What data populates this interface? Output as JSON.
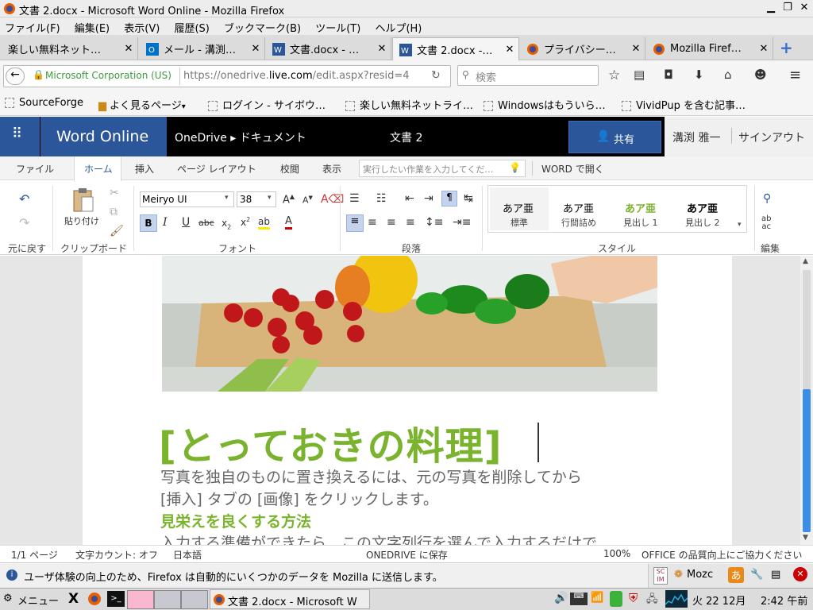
{
  "window": {
    "title": "文書 2.docx - Microsoft Word Online - Mozilla Firefox"
  },
  "menubar": [
    "ファイル(F)",
    "編集(E)",
    "表示(V)",
    "履歴(S)",
    "ブックマーク(B)",
    "ツール(T)",
    "ヘルプ(H)"
  ],
  "tabs": [
    {
      "label": "楽しい無料ネット…"
    },
    {
      "label": "メール - 溝渕…"
    },
    {
      "label": "文書.docx - …"
    },
    {
      "label": "文書 2.docx -…"
    },
    {
      "label": "プライバシー…"
    },
    {
      "label": "Mozilla Firef…"
    }
  ],
  "nav": {
    "site_identity": "Microsoft Corporation (US)",
    "url_prefix": "https://onedrive.",
    "url_domain": "live.com",
    "url_suffix": "/edit.aspx?resid=4",
    "search_placeholder": "検索"
  },
  "bookmarks": [
    "SourceForge",
    "よく見るページ",
    "ログイン - サイボウ…",
    "楽しい無料ネットライ…",
    "Windowsはもういら…",
    "VividPup を含む記事…"
  ],
  "word": {
    "app_title": "Word Online",
    "breadcrumb_root": "OneDrive",
    "breadcrumb_sep": "▸",
    "breadcrumb_folder": "ドキュメント",
    "doc_name": "文書 2",
    "share_label": "共有",
    "user_name": "溝渕 雅一",
    "signout_label": "サインアウト"
  },
  "ribbon_tabs": [
    "ファイル",
    "ホーム",
    "挿入",
    "ページ レイアウト",
    "校閲",
    "表示"
  ],
  "ribbon": {
    "tell_me_placeholder": "実行したい作業を入力してくだ…",
    "open_in_word": "WORD で開く",
    "paste_label": "貼り付け",
    "font_name": "Meiryo UI",
    "font_size": "38",
    "groups": {
      "undo": "元に戻す",
      "clipboard": "クリップボード",
      "font": "フォント",
      "paragraph": "段落",
      "styles": "スタイル",
      "editing": "編集"
    },
    "styles": [
      {
        "sample": "あア亜",
        "name": "標準"
      },
      {
        "sample": "あア亜",
        "name": "行間詰め"
      },
      {
        "sample": "あア亜",
        "name": "見出し 1"
      },
      {
        "sample": "あア亜",
        "name": "見出し 2"
      }
    ]
  },
  "document": {
    "title": "[とっておきの料理]",
    "body_line1": "写真を独自のものに置き換えるには、元の写真を削除してから",
    "body_line2": "[挿入] タブの [画像] をクリックします。",
    "heading": "見栄えを良くする方法",
    "body_line3": "入力する準備ができたら、この文字列行を選んで入力するだけで"
  },
  "status": {
    "pages": "1/1 ページ",
    "word_count": "文字カウント: オフ",
    "language": "日本語",
    "saved": "ONEDRIVE に保存",
    "zoom": "100%",
    "feedback": "OFFICE の品質向上にご協力ください"
  },
  "notification": {
    "message": "ユーザ体験の向上のため、Firefox は自動的にいくつかのデータを Mozilla に送信します。",
    "ime_label": "Mozc",
    "ime_mode": "あ"
  },
  "taskbar": {
    "menu_label": "メニュー",
    "window_label": "文書 2.docx - Microsoft W",
    "clock_date": "火 22 12月",
    "clock_time": "2:42 午前"
  },
  "colors": {
    "accent_green": "#7ab32e",
    "word_blue": "#2b579a",
    "share_blue": "#2b579a"
  }
}
